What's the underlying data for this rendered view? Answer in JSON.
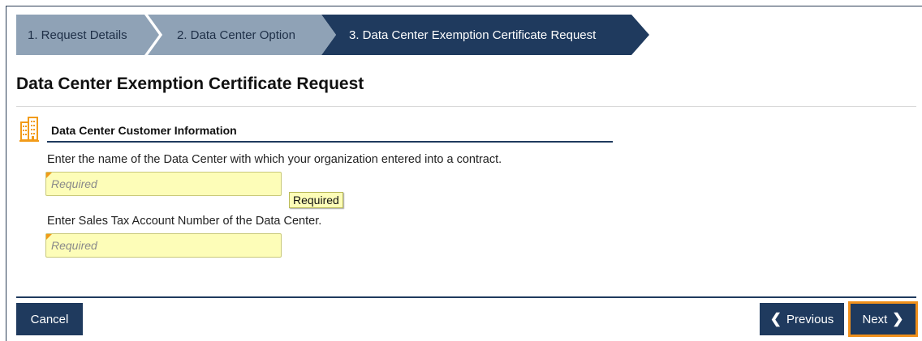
{
  "wizard": {
    "steps": [
      {
        "label": "1. Request Details"
      },
      {
        "label": "2. Data Center Option"
      },
      {
        "label": "3. Data Center Exemption Certificate Request"
      }
    ]
  },
  "page": {
    "title": "Data Center Exemption Certificate Request"
  },
  "section": {
    "title": "Data Center Customer Information",
    "icon": "building-icon"
  },
  "fields": {
    "data_center_name": {
      "label": "Enter the name of the Data Center with which your organization entered into a contract.",
      "value": "",
      "placeholder": "Required",
      "tooltip": "Required"
    },
    "sales_tax_account": {
      "label": "Enter Sales Tax Account Number of the Data Center.",
      "value": "",
      "placeholder": "Required"
    }
  },
  "footer": {
    "cancel_label": "Cancel",
    "previous_label": "Previous",
    "next_label": "Next"
  },
  "colors": {
    "primary": "#1f3a5e",
    "inactive_step": "#8fa2b6",
    "required_field": "#fdfdb8",
    "focus_outline": "#f0901c",
    "icon": "#f29b19"
  }
}
